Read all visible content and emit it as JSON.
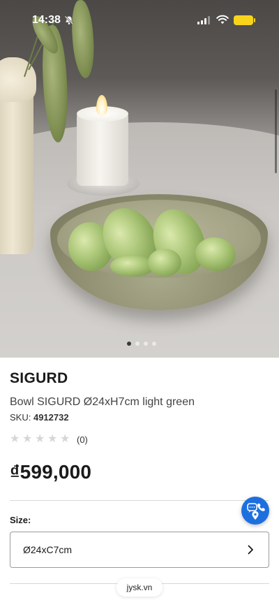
{
  "status_bar": {
    "time": "14:38",
    "battery_color": "#F8D41C"
  },
  "hero": {
    "image_alt_icon": "product-photo",
    "gallery_dots": 4,
    "active_dot": 1
  },
  "product": {
    "brand": "SIGURD",
    "description": "Bowl SIGURD Ø24xH7cm light green",
    "sku_label": "SKU:",
    "sku_value": "4912732",
    "rating_stars_filled": 0,
    "rating_stars_total": 5,
    "review_count": "(0)",
    "price": "₫599,000"
  },
  "size": {
    "label": "Size:",
    "selected": "Ø24xC7cm"
  },
  "contact_button": {
    "icon": "chat-phone-location-icon",
    "color": "#1D6FE0"
  },
  "browser": {
    "url": "jysk.vn"
  }
}
